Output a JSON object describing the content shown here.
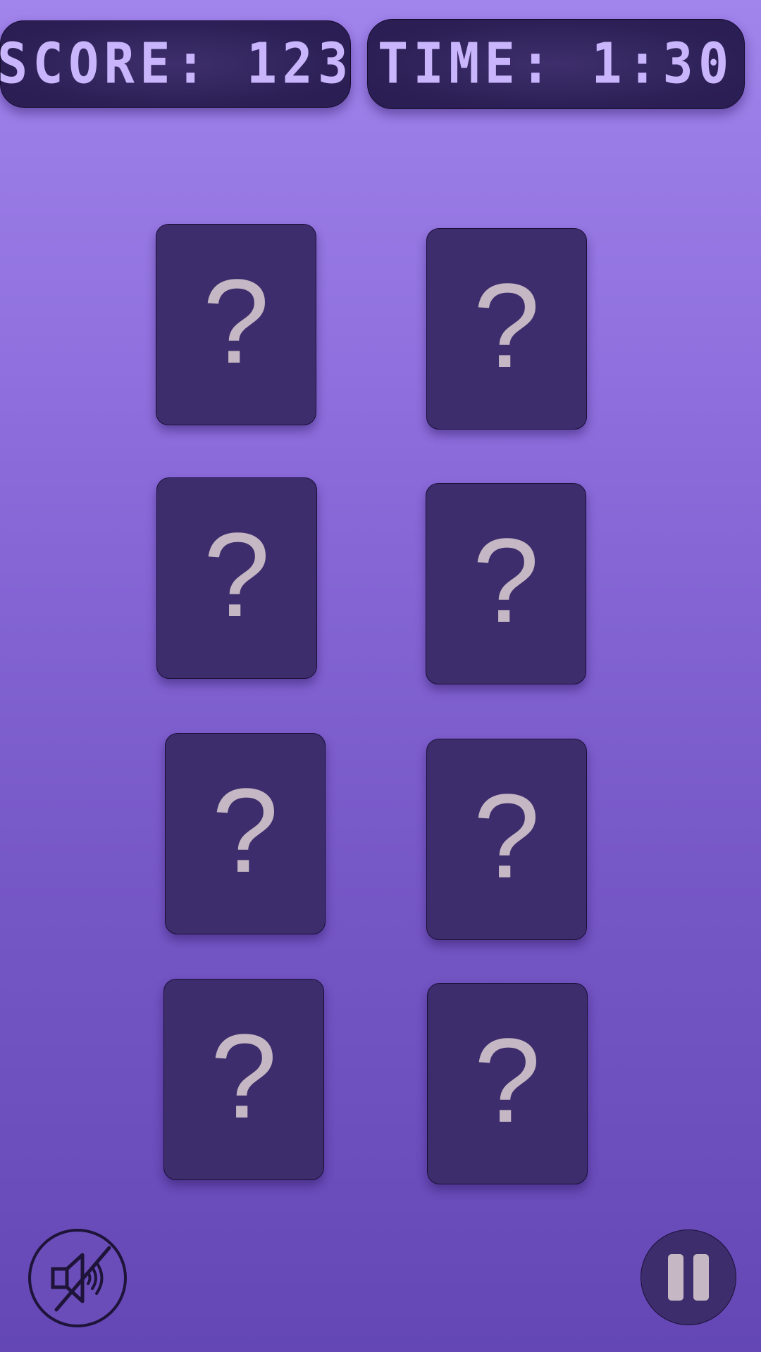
{
  "hud": {
    "score_text": "SCORE: 123",
    "time_text": "TIME: 1:30"
  },
  "cards": [
    {
      "label": "?",
      "state": "face-down"
    },
    {
      "label": "?",
      "state": "face-down"
    },
    {
      "label": "?",
      "state": "face-down"
    },
    {
      "label": "?",
      "state": "face-down"
    },
    {
      "label": "?",
      "state": "face-down"
    },
    {
      "label": "?",
      "state": "face-down"
    },
    {
      "label": "?",
      "state": "face-down"
    },
    {
      "label": "?",
      "state": "face-down"
    }
  ],
  "controls": {
    "mute_icon": "speaker-muted-icon",
    "pause_icon": "pause-icon"
  },
  "colors": {
    "background_top": "#a184ec",
    "background_bottom": "#6447b4",
    "pill": "#2c1f55",
    "hud_text": "#c8b5fb",
    "card": "#3e2d6c",
    "card_glyph": "#c5b8c4"
  }
}
